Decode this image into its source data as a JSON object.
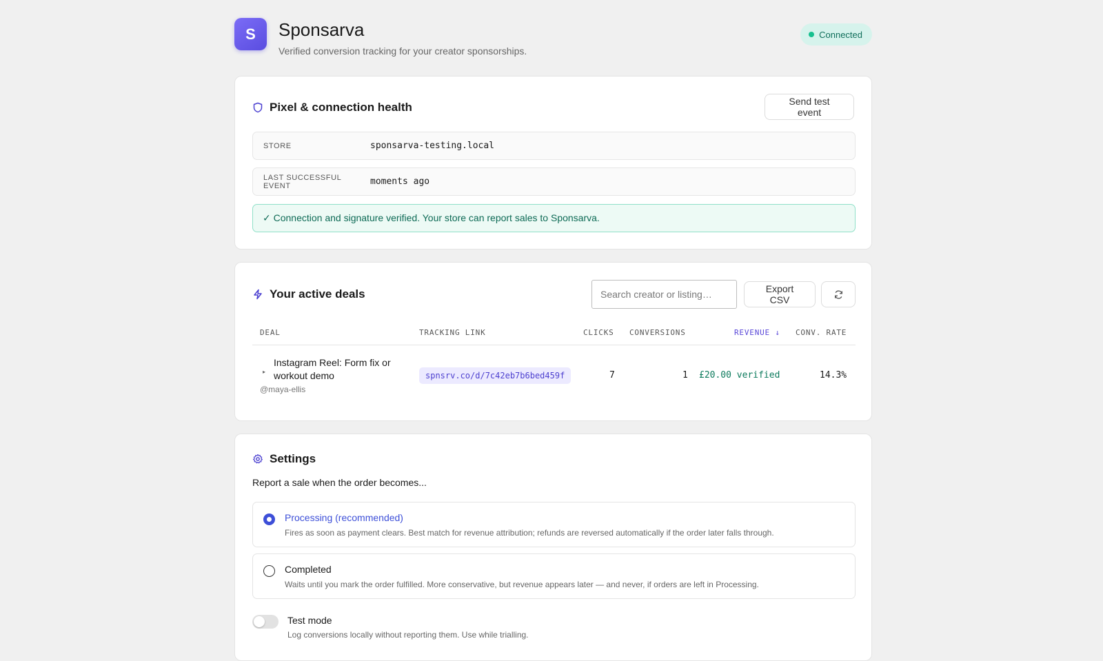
{
  "app": {
    "logo_letter": "S",
    "title": "Sponsarva",
    "subtitle": "Verified conversion tracking for your creator sponsorships.",
    "status": "Connected"
  },
  "health": {
    "title": "Pixel & connection health",
    "send_test_label": "Send test event",
    "rows": [
      {
        "label": "STORE",
        "value": "sponsarva-testing.local"
      },
      {
        "label": "LAST SUCCESSFUL EVENT",
        "value": "moments ago"
      }
    ],
    "banner": "✓ Connection and signature verified. Your store can report sales to Sponsarva."
  },
  "deals": {
    "title": "Your active deals",
    "search_placeholder": "Search creator or listing…",
    "export_label": "Export CSV",
    "columns": {
      "deal": "DEAL",
      "tracking": "TRACKING LINK",
      "clicks": "CLICKS",
      "conversions": "CONVERSIONS",
      "revenue": "REVENUE ↓",
      "rate": "CONV. RATE"
    },
    "rows": [
      {
        "title": "Instagram Reel: Form fix or workout demo",
        "handle": "@maya-ellis",
        "link": "spnsrv.co/d/7c42eb7b6bed459f",
        "clicks": "7",
        "conversions": "1",
        "revenue": "£20.00 verified",
        "rate": "14.3%"
      }
    ]
  },
  "settings": {
    "title": "Settings",
    "prompt": "Report a sale when the order becomes...",
    "options": [
      {
        "label": "Processing (recommended)",
        "desc": "Fires as soon as payment clears. Best match for revenue attribution; refunds are reversed automatically if the order later falls through.",
        "selected": true
      },
      {
        "label": "Completed",
        "desc": "Waits until you mark the order fulfilled. More conservative, but revenue appears later — and never, if orders are left in Processing.",
        "selected": false
      }
    ],
    "test_mode": {
      "label": "Test mode",
      "desc": "Log conversions locally without reporting them. Use while trialling.",
      "enabled": false
    }
  },
  "colors": {
    "accent": "#5846d8",
    "success": "#0c7a5c",
    "background": "#f0f0f0"
  }
}
